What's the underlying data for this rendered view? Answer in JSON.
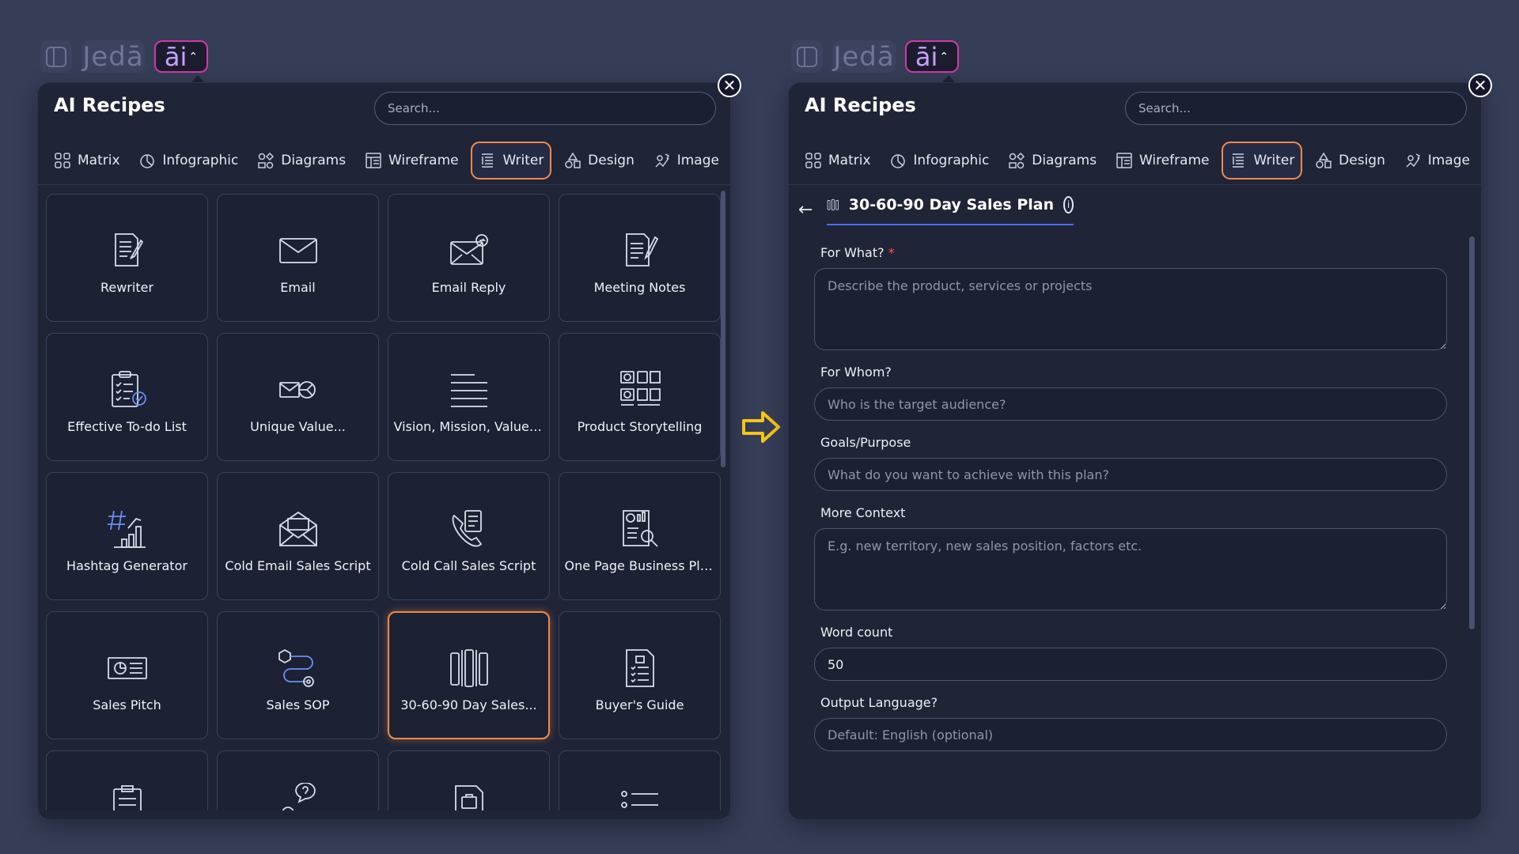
{
  "brand": {
    "logo": "Jedā",
    "ai_label": "āi",
    "ai_chevron": "^"
  },
  "panel_title": "AI Recipes",
  "search_placeholder": "Search...",
  "tabs": [
    {
      "label": "Matrix",
      "icon": "matrix-icon"
    },
    {
      "label": "Infographic",
      "icon": "infographic-icon"
    },
    {
      "label": "Diagrams",
      "icon": "diagrams-icon"
    },
    {
      "label": "Wireframe",
      "icon": "wireframe-icon"
    },
    {
      "label": "Writer",
      "icon": "writer-icon",
      "active": true
    },
    {
      "label": "Design",
      "icon": "design-icon"
    },
    {
      "label": "Image",
      "icon": "image-icon"
    }
  ],
  "recipes": [
    {
      "label": "Rewriter",
      "icon": "document-pen-icon"
    },
    {
      "label": "Email",
      "icon": "envelope-icon"
    },
    {
      "label": "Email Reply",
      "icon": "email-reply-icon"
    },
    {
      "label": "Meeting Notes",
      "icon": "meeting-notes-icon"
    },
    {
      "label": "Effective To-do List",
      "icon": "todo-clipboard-icon"
    },
    {
      "label": "Unique Value...",
      "icon": "unique-value-icon"
    },
    {
      "label": "Vision, Mission, Values...",
      "icon": "lines-icon"
    },
    {
      "label": "Product Storytelling",
      "icon": "storyboard-icon"
    },
    {
      "label": "Hashtag Generator",
      "icon": "hashtag-chart-icon"
    },
    {
      "label": "Cold Email Sales Script",
      "icon": "open-envelope-icon"
    },
    {
      "label": "Cold Call Sales Script",
      "icon": "phone-script-icon"
    },
    {
      "label": "One Page Business Plan",
      "icon": "business-plan-icon"
    },
    {
      "label": "Sales Pitch",
      "icon": "sales-pitch-icon"
    },
    {
      "label": "Sales SOP",
      "icon": "sales-sop-icon"
    },
    {
      "label": "30-60-90 Day Sales...",
      "icon": "columns-icon",
      "selected": true
    },
    {
      "label": "Buyer's Guide",
      "icon": "buyers-guide-icon"
    }
  ],
  "recipe_detail": {
    "title": "30-60-90 Day Sales Plan",
    "info": "i",
    "back": "←",
    "fields": [
      {
        "label": "For What?",
        "required_mark": "*",
        "type": "textarea",
        "value": "",
        "placeholder": "Describe the product, services or projects"
      },
      {
        "label": "For Whom?",
        "type": "input",
        "value": "",
        "placeholder": "Who is the target audience?"
      },
      {
        "label": "Goals/Purpose",
        "type": "input",
        "value": "",
        "placeholder": "What do you want to achieve with this plan?"
      },
      {
        "label": "More Context",
        "type": "textarea",
        "value": "",
        "placeholder": "E.g. new territory, new sales position, factors etc."
      },
      {
        "label": "Word count",
        "type": "input",
        "value": "50",
        "placeholder": ""
      },
      {
        "label": "Output Language?",
        "type": "input",
        "value": "",
        "placeholder": "Default: English (optional)"
      }
    ]
  },
  "close_label": "✕",
  "colors": {
    "accent": "#f08a4b",
    "ai_border": "#d239a8",
    "arrow": "#f5c518",
    "panel": "#1f2437",
    "background": "#363d57",
    "underline": "#4a6cf0"
  }
}
